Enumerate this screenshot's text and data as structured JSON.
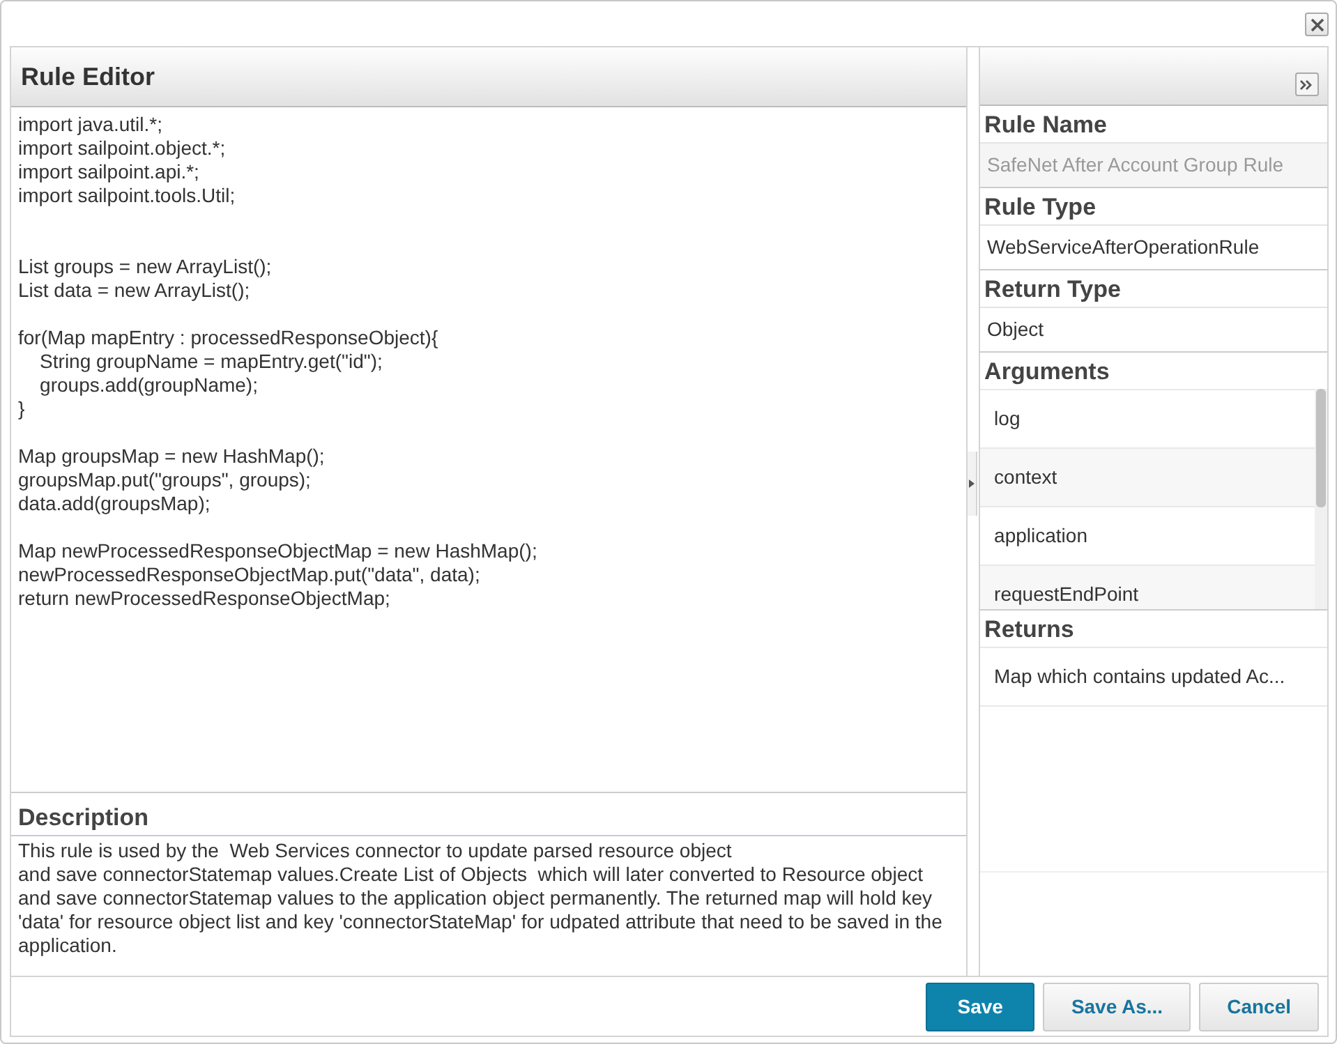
{
  "editor": {
    "title": "Rule Editor",
    "code": "import java.util.*;\nimport sailpoint.object.*;\nimport sailpoint.api.*;\nimport sailpoint.tools.Util;\n\n\nList groups = new ArrayList();\nList data = new ArrayList();\n\nfor(Map mapEntry : processedResponseObject){\n    String groupName = mapEntry.get(\"id\");\n    groups.add(groupName);\n}\n\nMap groupsMap = new HashMap();\ngroupsMap.put(\"groups\", groups);\ndata.add(groupsMap);\n\nMap newProcessedResponseObjectMap = new HashMap();\nnewProcessedResponseObjectMap.put(\"data\", data);\nreturn newProcessedResponseObjectMap;"
  },
  "description": {
    "title": "Description",
    "text": "This rule is used by the  Web Services connector to update parsed resource object\nand save connectorStatemap values.Create List of Objects  which will later converted to Resource object and save connectorStatemap values to the application object permanently. The returned map will hold key 'data' for resource object list and key 'connectorStateMap' for udpated attribute that need to be saved in the application."
  },
  "details": {
    "sections": [
      {
        "kind": "field",
        "title": "Rule Name",
        "value": "SafeNet After Account Group Rule",
        "disabled": true
      },
      {
        "kind": "field",
        "title": "Rule Type",
        "value": "WebServiceAfterOperationRule",
        "disabled": false
      },
      {
        "kind": "field",
        "title": "Return Type",
        "value": "Object",
        "disabled": false
      },
      {
        "kind": "list",
        "title": "Arguments",
        "items": [
          "log",
          "context",
          "application",
          "requestEndPoint"
        ],
        "scroll": true
      },
      {
        "kind": "list",
        "title": "Returns",
        "items": [
          "Map which contains updated Ac..."
        ],
        "scroll": false
      }
    ]
  },
  "buttons": [
    {
      "label": "Save",
      "primary": true
    },
    {
      "label": "Save As...",
      "primary": false
    },
    {
      "label": "Cancel",
      "primary": false
    }
  ]
}
